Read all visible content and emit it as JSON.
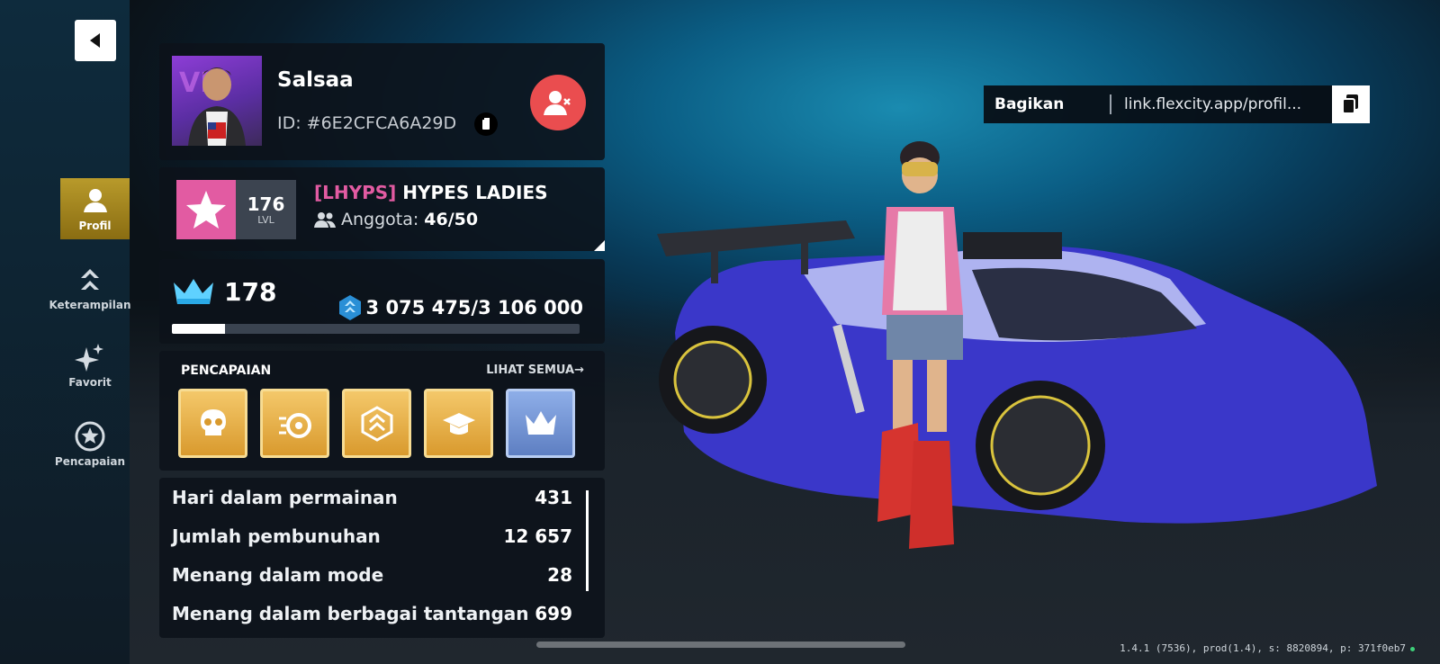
{
  "sidebar": {
    "back_icon": "back-arrow-icon",
    "items": [
      {
        "label": "Profil",
        "icon": "person-icon",
        "active": true
      },
      {
        "label": "Keterampilan",
        "icon": "double-chevron-up-icon",
        "active": false
      },
      {
        "label": "Favorit",
        "icon": "sparkle-icon",
        "active": false
      },
      {
        "label": "Pencapaian",
        "icon": "star-circle-icon",
        "active": false
      }
    ]
  },
  "profile": {
    "username": "Salsaa",
    "player_id": "ID: #6E2CFCA6A29D",
    "remove_friend_icon": "remove-user-icon"
  },
  "clan": {
    "level": "176",
    "level_label": "LVL",
    "tag": "[LHYPS]",
    "name": "HYPES LADIES",
    "members_label": "Anggota:",
    "members_value": "46/50"
  },
  "rank": {
    "rank_value": "178",
    "xp_text": "3 075 475/3 106 000",
    "progress_percent": 13
  },
  "achievements": {
    "title": "PENCAPAIAN",
    "see_all": "LIHAT SEMUA→",
    "badges": [
      {
        "icon": "skull-icon",
        "color": "gold"
      },
      {
        "icon": "wheel-speed-icon",
        "color": "gold"
      },
      {
        "icon": "rank-chevron-icon",
        "color": "gold"
      },
      {
        "icon": "graduation-cap-icon",
        "color": "gold"
      },
      {
        "icon": "crown-icon",
        "color": "blue"
      }
    ]
  },
  "stats": [
    {
      "label": "Hari dalam permainan",
      "value": "431"
    },
    {
      "label": "Jumlah pembunuhan",
      "value": "12 657"
    },
    {
      "label": "Menang dalam mode",
      "value": "28"
    },
    {
      "label": "Menang dalam berbagai tantangan",
      "value": "699"
    }
  ],
  "share": {
    "label": "Bagikan",
    "url": "link.flexcity.app/profil..."
  },
  "version": "1.4.1 (7536), prod(1.4), s: 8820894, p: 371f0eb7",
  "colors": {
    "accent_pink": "#e25ba2",
    "remove_red": "#ea4d4f",
    "active_gold": "#b89a2b"
  }
}
